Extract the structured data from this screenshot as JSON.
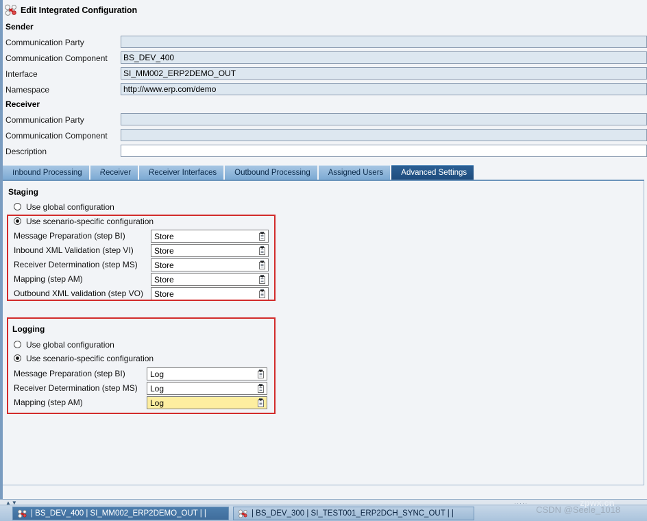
{
  "window": {
    "title": "Edit Integrated Configuration",
    "title_icon": "integrated-configuration-icon"
  },
  "sender": {
    "heading": "Sender",
    "fields": [
      {
        "label": "Communication Party",
        "value": "",
        "readonly": true
      },
      {
        "label": "Communication Component",
        "value": "BS_DEV_400",
        "readonly": true
      },
      {
        "label": "Interface",
        "value": "SI_MM002_ERP2DEMO_OUT",
        "readonly": true
      },
      {
        "label": "Namespace",
        "value": "http://www.erp.com/demo",
        "readonly": true
      }
    ]
  },
  "receiver": {
    "heading": "Receiver",
    "fields": [
      {
        "label": "Communication Party",
        "value": "",
        "readonly": true
      },
      {
        "label": "Communication Component",
        "value": "",
        "readonly": true
      },
      {
        "label": "Description",
        "value": "",
        "readonly": false
      }
    ]
  },
  "tabs": [
    {
      "label": "Inbound Processing",
      "active": false
    },
    {
      "label": "Receiver",
      "active": false
    },
    {
      "label": "Receiver Interfaces",
      "active": false
    },
    {
      "label": "Outbound Processing",
      "active": false
    },
    {
      "label": "Assigned Users",
      "active": false
    },
    {
      "label": "Advanced Settings",
      "active": true
    }
  ],
  "staging": {
    "heading": "Staging",
    "radio_global": "Use global configuration",
    "radio_scenario": "Use scenario-specific configuration",
    "selected": "scenario",
    "rows": [
      {
        "label": "Message Preparation (step BI)",
        "value": "Store"
      },
      {
        "label": "Inbound XML Validation (step VI)",
        "value": "Store"
      },
      {
        "label": "Receiver Determination (step MS)",
        "value": "Store"
      },
      {
        "label": "Mapping (step AM)",
        "value": "Store"
      },
      {
        "label": "Outbound XML validation (step VO)",
        "value": "Store"
      }
    ]
  },
  "logging": {
    "heading": "Logging",
    "radio_global": "Use global configuration",
    "radio_scenario": "Use scenario-specific configuration",
    "selected": "scenario",
    "rows": [
      {
        "label": "Message Preparation (step BI)",
        "value": "Log",
        "highlight": false
      },
      {
        "label": "Receiver Determination (step MS)",
        "value": "Log",
        "highlight": false
      },
      {
        "label": "Mapping (step AM)",
        "value": "Log",
        "highlight": true
      }
    ]
  },
  "taskbar": {
    "items": [
      {
        "label": "| BS_DEV_400 | SI_MM002_ERP2DEMO_OUT |  |",
        "active": true
      },
      {
        "label": "| BS_DEV_300 | SI_TEST001_ERP2DCH_SYNC_OUT |  |",
        "active": false
      }
    ]
  },
  "watermark": {
    "csdn": "CSDN @Seele_1018",
    "site": "zpwx.cn",
    "dots": "·····"
  },
  "colors": {
    "accent_tab_active": "#1e4c7d",
    "annotation_red": "#d22b2b",
    "field_readonly": "#dde7f0",
    "field_highlight": "#fdeea0"
  }
}
